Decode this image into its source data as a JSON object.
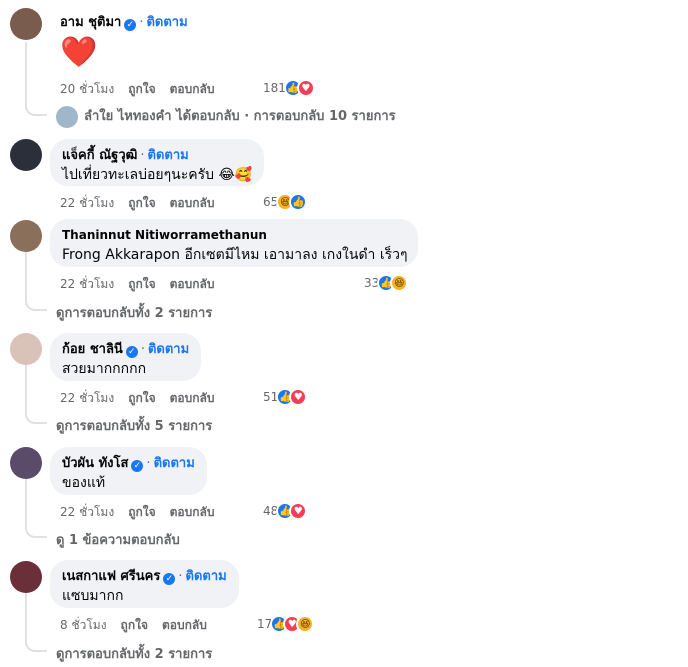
{
  "comments": [
    {
      "author": "อาม ชุติมา",
      "verified": true,
      "follow": "ติดตาม",
      "text": "❤️",
      "time": "20 ชั่วโมง",
      "like": "ถูกใจ",
      "reply": "ตอบกลับ",
      "reaction_count": "181",
      "reactions": [
        "like-icon",
        "love-icon"
      ],
      "reply_summary": "ลำใย ไหทองคำ ได้ตอบกลับ · การตอบกลับ 10 รายการ",
      "avatar_color": "#7a5c4e"
    },
    {
      "author": "แจ็คกี้ ณัฐวุฒิ",
      "verified": false,
      "follow": "ติดตาม",
      "text": "ไปเที่ยวทะเลบ่อยๆนะครับ 😂🥰",
      "time": "22 ชั่วโมง",
      "like": "ถูกใจ",
      "reply": "ตอบกลับ",
      "reaction_count": "65",
      "reactions": [
        "haha-icon",
        "like-icon"
      ],
      "reply_summary": "",
      "avatar_color": "#2b2f3a"
    },
    {
      "author": "Thaninnut Nitiworramethanun",
      "verified": false,
      "follow": "",
      "text": "Frong Akkarapon อีกเซตมีไหม เอามาลง เกงในดำ เร็วๆ",
      "time": "22 ชั่วโมง",
      "like": "ถูกใจ",
      "reply": "ตอบกลับ",
      "reaction_count": "33",
      "reactions": [
        "like-icon",
        "haha-icon"
      ],
      "reply_summary": "ดูการตอบกลับทั้ง 2 รายการ",
      "avatar_color": "#8a6f5a"
    },
    {
      "author": "ก้อย ชาลินี",
      "verified": true,
      "follow": "ติดตาม",
      "text": "สวยมากกกกก",
      "time": "22 ชั่วโมง",
      "like": "ถูกใจ",
      "reply": "ตอบกลับ",
      "reaction_count": "51",
      "reactions": [
        "like-icon",
        "love-icon"
      ],
      "reply_summary": "ดูการตอบกลับทั้ง 5 รายการ",
      "avatar_color": "#d9c2b8"
    },
    {
      "author": "บัวผัน ทังโส",
      "verified": true,
      "follow": "ติดตาม",
      "text": "ของแท้",
      "time": "22 ชั่วโมง",
      "like": "ถูกใจ",
      "reply": "ตอบกลับ",
      "reaction_count": "48",
      "reactions": [
        "like-icon",
        "love-icon"
      ],
      "reply_summary": "ดู 1 ข้อความตอบกลับ",
      "avatar_color": "#5b4b6b"
    },
    {
      "author": "เนสกาแฟ ศรีนคร",
      "verified": true,
      "follow": "ติดตาม",
      "text": "แซบมากก",
      "time": "8 ชั่วโมง",
      "like": "ถูกใจ",
      "reply": "ตอบกลับ",
      "reaction_count": "17",
      "reactions": [
        "like-icon",
        "love-icon",
        "haha-icon"
      ],
      "reply_summary": "ดูการตอบกลับทั้ง 2 รายการ",
      "avatar_color": "#6b2f3a"
    }
  ]
}
